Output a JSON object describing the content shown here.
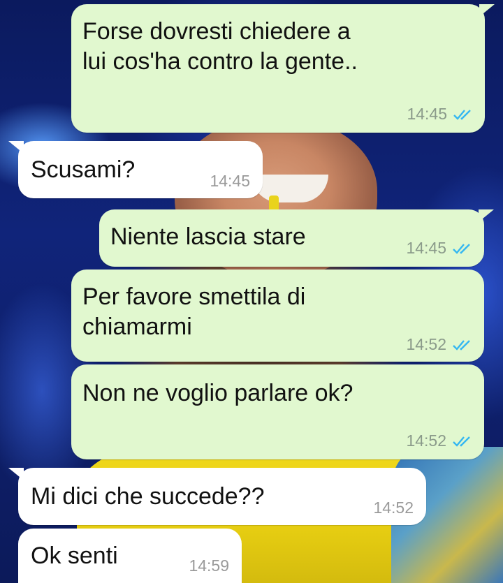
{
  "messages": [
    {
      "direction": "outgoing",
      "text": "Forse dovresti chiedere a\nlui cos'ha contro la gente..",
      "time": "14:45",
      "status": "read"
    },
    {
      "direction": "incoming",
      "text": "Scusami?",
      "time": "14:45"
    },
    {
      "direction": "outgoing",
      "text": "Niente lascia stare",
      "time": "14:45",
      "status": "read"
    },
    {
      "direction": "outgoing",
      "text": "Per favore smettila di\nchiamarmi",
      "time": "14:52",
      "status": "read"
    },
    {
      "direction": "outgoing",
      "text": "Non ne voglio parlare ok?",
      "time": "14:52",
      "status": "read"
    },
    {
      "direction": "incoming",
      "text": "Mi dici che succede??",
      "time": "14:52"
    },
    {
      "direction": "incoming",
      "text": "Ok senti",
      "time": "14:59"
    }
  ],
  "colors": {
    "outgoing_bubble": "#e1f8cf",
    "incoming_bubble": "#ffffff",
    "read_ticks": "#34b7f1"
  },
  "icons": {
    "read_receipt": "double-check-icon"
  }
}
